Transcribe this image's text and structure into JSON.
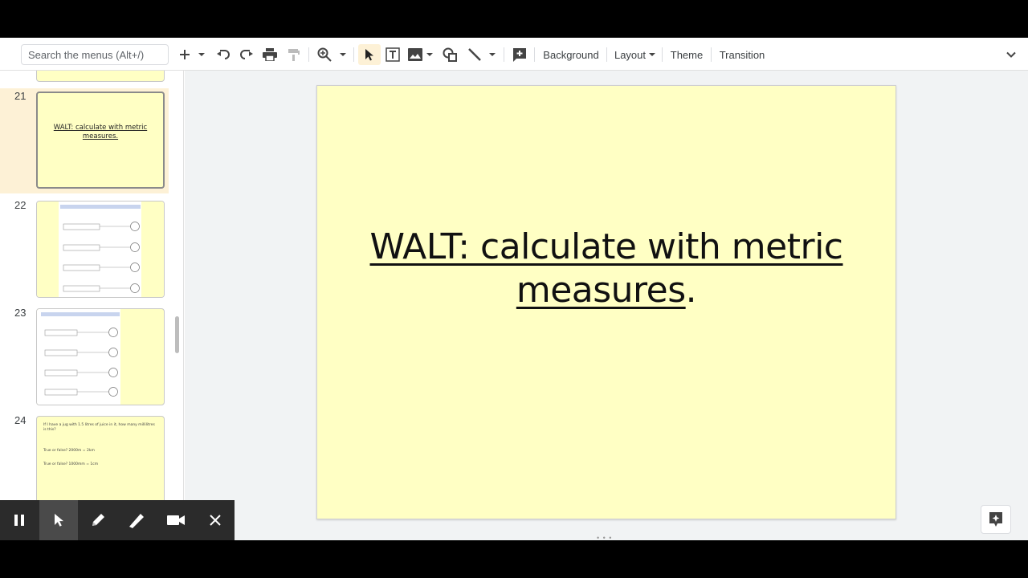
{
  "toolbar": {
    "search_placeholder": "Search the menus (Alt+/)",
    "background_label": "Background",
    "layout_label": "Layout",
    "theme_label": "Theme",
    "transition_label": "Transition"
  },
  "filmstrip": {
    "slides": [
      {
        "number": "21",
        "title": "WALT: calculate with metric measures."
      },
      {
        "number": "22"
      },
      {
        "number": "23"
      },
      {
        "number": "24",
        "line1": "If I have a jug with 1.5 litres of juice in it, how many millilitres is this?",
        "line2": "True or false? 2000m = 2km",
        "line3": "True or false? 1000mm = 1cm"
      }
    ]
  },
  "slide": {
    "title_part1": "WALT: calculate with metric",
    "title_part2": "measures",
    "title_end": ".",
    "background_color": "#ffffc4"
  },
  "recording_toolbar": {
    "icons": [
      "pause-icon",
      "pointer-icon",
      "pen-icon",
      "highlighter-icon",
      "camera-icon",
      "close-icon"
    ]
  }
}
